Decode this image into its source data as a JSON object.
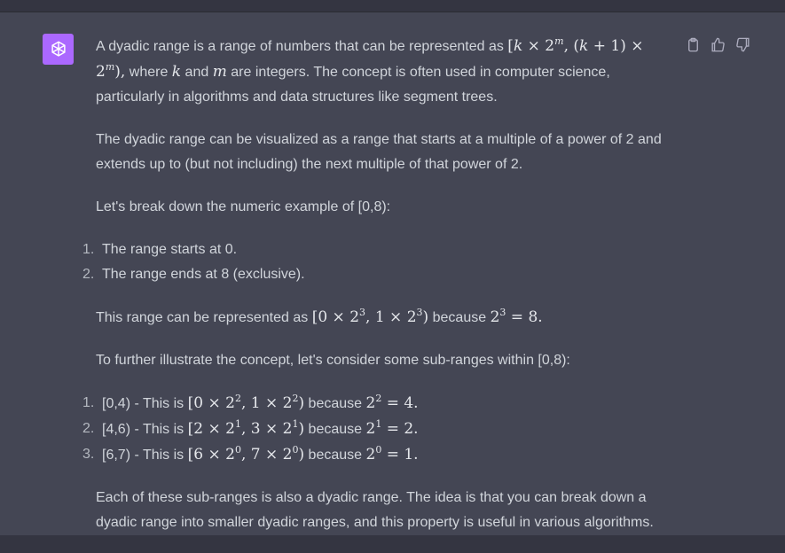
{
  "actions": {
    "copy_icon": "clipboard-icon",
    "like_icon": "thumbs-up-icon",
    "dislike_icon": "thumbs-down-icon"
  },
  "message": {
    "p1_a": "A dyadic range is a range of numbers that can be represented as ",
    "p1_math": "[k × 2^m, (k + 1) × 2^m),",
    "p1_b": " where ",
    "p1_k": "k",
    "p1_c": " and ",
    "p1_m": "m",
    "p1_d": " are integers. The concept is often used in computer science, particularly in algorithms and data structures like segment trees.",
    "p2": "The dyadic range can be visualized as a range that starts at a multiple of a power of 2 and extends up to (but not including) the next multiple of that power of 2.",
    "p3": "Let's break down the numeric example of [0,8):",
    "list1": [
      {
        "num": "1.",
        "text": "The range starts at 0."
      },
      {
        "num": "2.",
        "text": "The range ends at 8 (exclusive)."
      }
    ],
    "p4_a": "This range can be represented as ",
    "p4_b": " because ",
    "p5": "To further illustrate the concept, let's consider some sub-ranges within [0,8):",
    "list2": [
      {
        "num": "1.",
        "prefix": "[0,4) - This is ",
        "because": " because "
      },
      {
        "num": "2.",
        "prefix": "[4,6) - This is ",
        "because": " because "
      },
      {
        "num": "3.",
        "prefix": "[6,7) - This is ",
        "because": " because "
      }
    ],
    "p6": "Each of these sub-ranges is also a dyadic range. The idea is that you can break down a dyadic range into smaller dyadic ranges, and this property is useful in various algorithms."
  }
}
